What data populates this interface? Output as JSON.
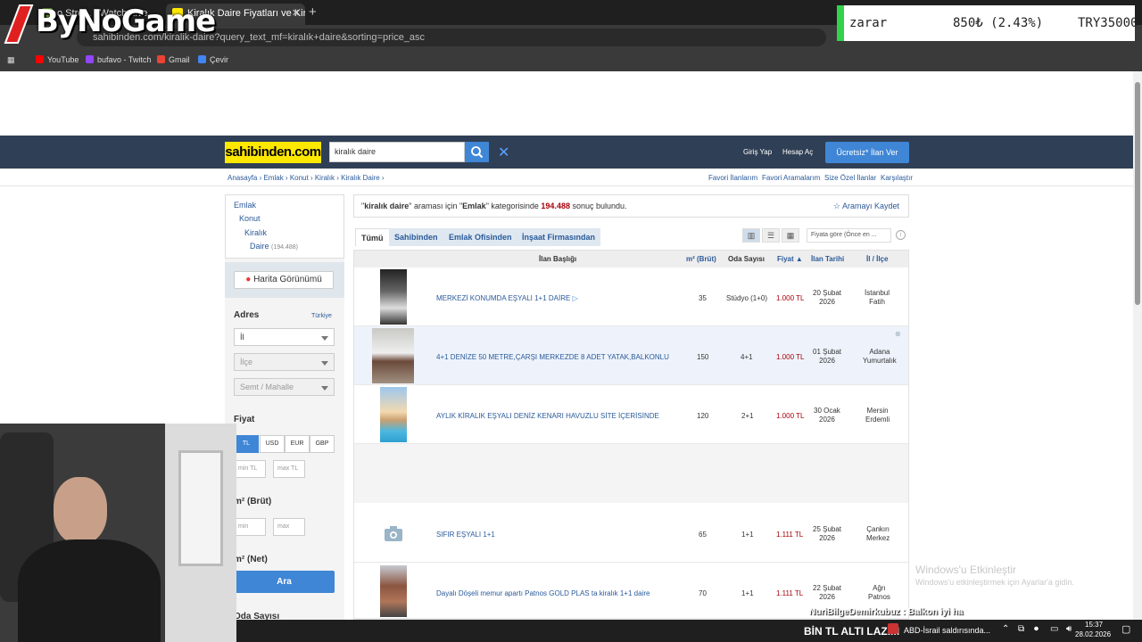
{
  "browser": {
    "tabs": [
      {
        "label": "o Stre... | Watch Live",
        "favicon_color": "#6a2"
      },
      {
        "label": "Kiralık Daire Fiyatları ve Kiralık E",
        "favicon_color": "#ffe800"
      }
    ],
    "new_tab": "+",
    "url": "sahibinden.com/kiralik-daire?query_text_mf=kiralık+daire&sorting=price_asc",
    "bookmarks": [
      {
        "label": "YouTube",
        "color": "#f00"
      },
      {
        "label": "bufavo - Twitch",
        "color": "#9146ff"
      },
      {
        "label": "Gmail",
        "color": "#ea4335"
      },
      {
        "label": "Çevir",
        "color": "#4285f4"
      }
    ]
  },
  "overlay": {
    "logo": "ByNoGame",
    "ticker": {
      "label": "zarar",
      "value": "850₺ (2.43%)",
      "total": "TRY35000"
    },
    "activation_title": "Windows'u Etkinleştir",
    "activation_sub": "Windows'u etkinleştirmek için Ayarlar'a gidin.",
    "chat": "NuriBilgeDemirkubuz : Balkon iyi ha",
    "taskbar": {
      "marquee": "BİN TL ALTI LAZIM",
      "news": "ABD-İsrail saldırısında...",
      "time": "15:37",
      "date": "28.02.2026"
    }
  },
  "site": {
    "brand": "sahibinden.com",
    "search_value": "kiralık daire",
    "header_links": [
      "Giriş Yap",
      "Hesap Aç"
    ],
    "post_ad": "Ücretsiz* İlan Ver",
    "breadcrumbs": [
      "Anasayfa",
      "Emlak",
      "Konut",
      "Kiralık",
      "Kiralık Daire"
    ],
    "right_links": [
      "Favori İlanlarım",
      "Favori Aramalarım",
      "Size Özel İlanlar",
      "Karşılaştır"
    ]
  },
  "sidebar": {
    "categories": [
      {
        "label": "Emlak",
        "count": ""
      },
      {
        "label": "Konut",
        "count": ""
      },
      {
        "label": "Kiralık",
        "count": ""
      },
      {
        "label": "Daire",
        "count": "(194.488)"
      }
    ],
    "map_button": "Harita Görünümü",
    "address_title": "Adres",
    "address_country": "Türkiye",
    "il": "İl",
    "ilce": "İlçe",
    "semt": "Semt / Mahalle",
    "price_title": "Fiyat",
    "currencies": [
      "TL",
      "USD",
      "EUR",
      "GBP"
    ],
    "min_tl": "min TL",
    "max_tl": "max TL",
    "m2_brut_title": "m² (Brüt)",
    "min": "min",
    "max": "max",
    "m2_net_title": "m² (Net)",
    "search_button": "Ara",
    "rooms_title": "Oda Sayısı"
  },
  "results": {
    "query": "kiralık daire",
    "text_1": "\" araması için \"",
    "category": "Emlak",
    "text_2": "\" kategorisinde ",
    "count": "194.488",
    "text_3": " sonuç bulundu.",
    "save_search": "Aramayı Kaydet",
    "tabs": [
      "Tümü",
      "Sahibinden",
      "Emlak Ofisinden",
      "İnşaat Firmasından"
    ],
    "sort": "Fiyata göre (Önce en ..."
  },
  "table": {
    "headers": [
      "İlan Başlığı",
      "m² (Brüt)",
      "Oda Sayısı",
      "Fiyat",
      "İlan Tarihi",
      "İl / İlçe"
    ],
    "rows": [
      {
        "title": "MERKEZİ KONUMDA EŞYALI 1+1 DAİRE",
        "m2": "35",
        "rooms": "Stüdyo (1+0)",
        "price": "1.000 TL",
        "date1": "20 Şubat",
        "date2": "2026",
        "loc1": "İstanbul",
        "loc2": "Fatih"
      },
      {
        "title": "4+1 DENİZE 50 METRE,ÇARŞI MERKEZDE 8 ADET YATAK,BALKONLU",
        "m2": "150",
        "rooms": "4+1",
        "price": "1.000 TL",
        "date1": "01 Şubat",
        "date2": "2026",
        "loc1": "Adana",
        "loc2": "Yumurtalık"
      },
      {
        "title": "AYLIK KİRALIK EŞYALI DENİZ KENARI HAVUZLU SİTE İÇERİSİNDE",
        "m2": "120",
        "rooms": "2+1",
        "price": "1.000 TL",
        "date1": "30 Ocak",
        "date2": "2026",
        "loc1": "Mersin",
        "loc2": "Erdemli"
      },
      {
        "title": "SIFIR EŞYALI 1+1",
        "m2": "65",
        "rooms": "1+1",
        "price": "1.111 TL",
        "date1": "25 Şubat",
        "date2": "2026",
        "loc1": "Çankırı",
        "loc2": "Merkez"
      },
      {
        "title": "Dayalı Döşeli memur apartı Patnos GOLD PLAS ta kiralık 1+1 daire",
        "m2": "70",
        "rooms": "1+1",
        "price": "1.111 TL",
        "date1": "22 Şubat",
        "date2": "2026",
        "loc1": "Ağrı",
        "loc2": "Patnos"
      }
    ]
  }
}
